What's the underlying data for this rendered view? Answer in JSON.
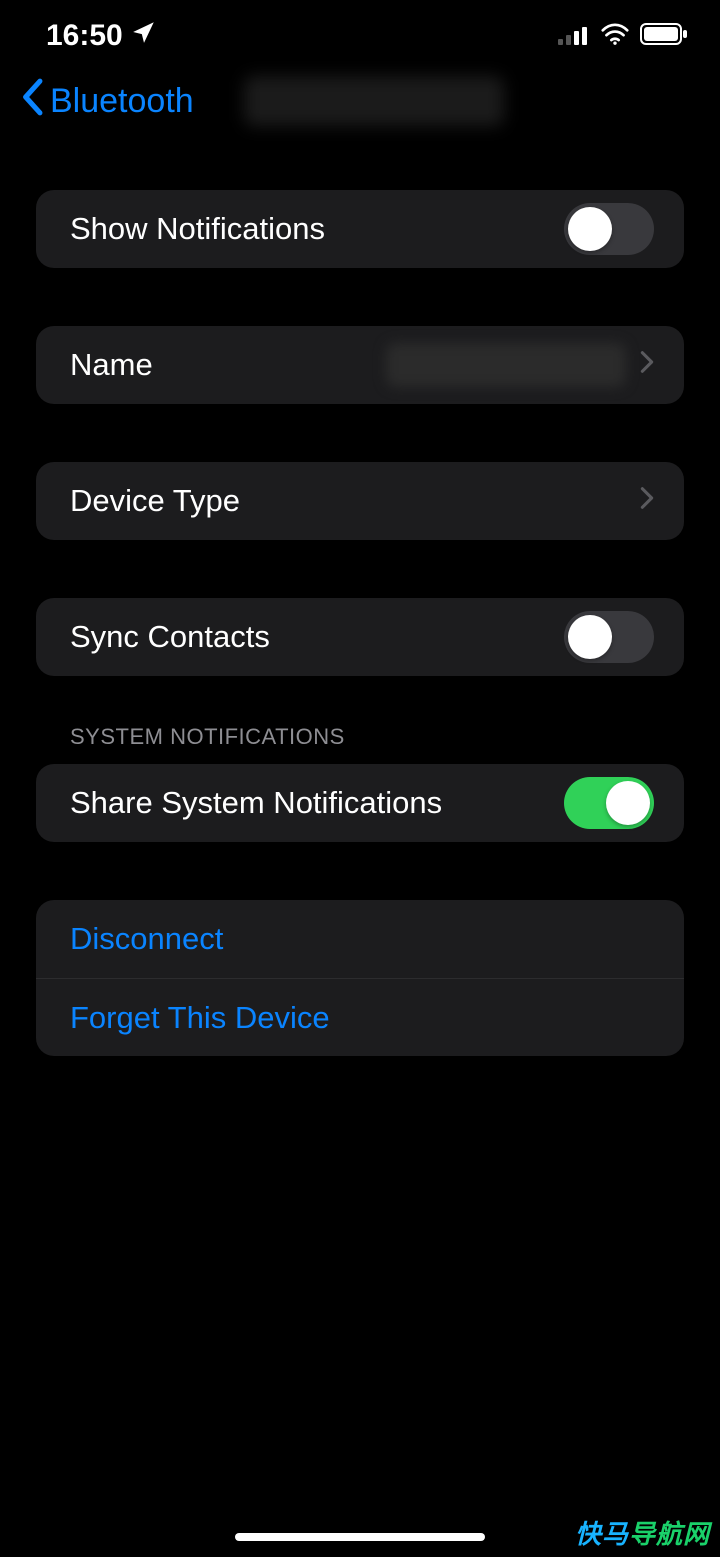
{
  "statusBar": {
    "time": "16:50"
  },
  "nav": {
    "back": "Bluetooth"
  },
  "rows": {
    "showNotifications": {
      "label": "Show Notifications",
      "on": false
    },
    "name": {
      "label": "Name"
    },
    "deviceType": {
      "label": "Device Type"
    },
    "syncContacts": {
      "label": "Sync Contacts",
      "on": false
    }
  },
  "sections": {
    "systemNotifications": {
      "header": "SYSTEM NOTIFICATIONS",
      "shareSystemNotifications": {
        "label": "Share System Notifications",
        "on": true
      }
    }
  },
  "actions": {
    "disconnect": "Disconnect",
    "forget": "Forget This Device"
  },
  "watermark": {
    "part1": "快马",
    "part2": "导航网"
  }
}
